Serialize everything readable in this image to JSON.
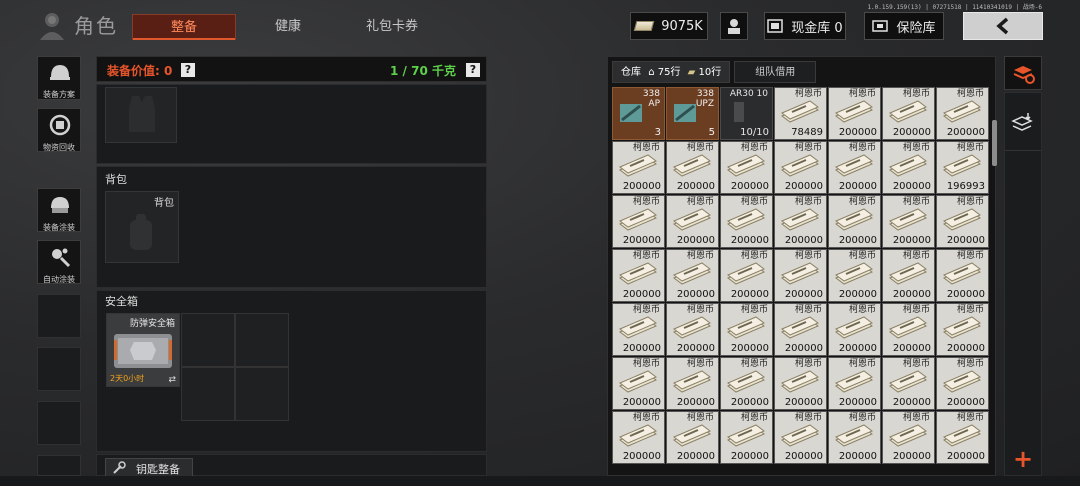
{
  "header": {
    "title": "角色",
    "version": "1.0.159.159(13) | 07271518 | 11410341019 | 战场-6",
    "tabs": [
      {
        "label": "整备",
        "active": true
      },
      {
        "label": "健康",
        "active": false
      },
      {
        "label": "礼包卡券",
        "active": false
      }
    ],
    "currency": "9075K",
    "cash_vault": "现金库 0",
    "safe_vault": "保险库"
  },
  "rail": {
    "items": [
      {
        "label": "装备方案",
        "icon": "helmet-icon"
      },
      {
        "label": "物资回收",
        "icon": "recycle-icon"
      },
      {
        "label": "装备涂装",
        "icon": "paint-helmet-icon"
      },
      {
        "label": "自动涂装",
        "icon": "auto-paint-icon"
      }
    ]
  },
  "equipment": {
    "value_label": "装备价值: 0",
    "help": "?",
    "weight": "1 / 70 千克",
    "backpack_title": "背包",
    "backpack_slot_label": "背包",
    "safebox_title": "安全箱",
    "safebox_item_name": "防弹安全箱",
    "safebox_timer": "2天0小时",
    "key_button": "钥匙整备"
  },
  "inventory": {
    "tab_warehouse": "仓库",
    "rows_label": "75行",
    "cash_rows_label": "10行",
    "tab_team_borrow": "组队借用",
    "columns": 7,
    "cells": [
      {
        "type": "ammo",
        "name": "338\nAP",
        "qty": "3"
      },
      {
        "type": "ammo",
        "name": "338\nUPZ",
        "qty": "5"
      },
      {
        "type": "mag",
        "name": "AR30 10",
        "qty": "10/10"
      },
      {
        "type": "cash",
        "name": "柯恩币",
        "qty": "78489"
      },
      {
        "type": "cash",
        "name": "柯恩币",
        "qty": "200000"
      },
      {
        "type": "cash",
        "name": "柯恩币",
        "qty": "200000"
      },
      {
        "type": "cash",
        "name": "柯恩币",
        "qty": "200000"
      },
      {
        "type": "cash",
        "name": "柯恩币",
        "qty": "200000"
      },
      {
        "type": "cash",
        "name": "柯恩币",
        "qty": "200000"
      },
      {
        "type": "cash",
        "name": "柯恩币",
        "qty": "200000"
      },
      {
        "type": "cash",
        "name": "柯恩币",
        "qty": "200000"
      },
      {
        "type": "cash",
        "name": "柯恩币",
        "qty": "200000"
      },
      {
        "type": "cash",
        "name": "柯恩币",
        "qty": "200000"
      },
      {
        "type": "cash",
        "name": "柯恩币",
        "qty": "196993"
      },
      {
        "type": "cash",
        "name": "柯恩币",
        "qty": "200000"
      },
      {
        "type": "cash",
        "name": "柯恩币",
        "qty": "200000"
      },
      {
        "type": "cash",
        "name": "柯恩币",
        "qty": "200000"
      },
      {
        "type": "cash",
        "name": "柯恩币",
        "qty": "200000"
      },
      {
        "type": "cash",
        "name": "柯恩币",
        "qty": "200000"
      },
      {
        "type": "cash",
        "name": "柯恩币",
        "qty": "200000"
      },
      {
        "type": "cash",
        "name": "柯恩币",
        "qty": "200000"
      },
      {
        "type": "cash",
        "name": "柯恩币",
        "qty": "200000"
      },
      {
        "type": "cash",
        "name": "柯恩币",
        "qty": "200000"
      },
      {
        "type": "cash",
        "name": "柯恩币",
        "qty": "200000"
      },
      {
        "type": "cash",
        "name": "柯恩币",
        "qty": "200000"
      },
      {
        "type": "cash",
        "name": "柯恩币",
        "qty": "200000"
      },
      {
        "type": "cash",
        "name": "柯恩币",
        "qty": "200000"
      },
      {
        "type": "cash",
        "name": "柯恩币",
        "qty": "200000"
      },
      {
        "type": "cash",
        "name": "柯恩币",
        "qty": "200000"
      },
      {
        "type": "cash",
        "name": "柯恩币",
        "qty": "200000"
      },
      {
        "type": "cash",
        "name": "柯恩币",
        "qty": "200000"
      },
      {
        "type": "cash",
        "name": "柯恩币",
        "qty": "200000"
      },
      {
        "type": "cash",
        "name": "柯恩币",
        "qty": "200000"
      },
      {
        "type": "cash",
        "name": "柯恩币",
        "qty": "200000"
      },
      {
        "type": "cash",
        "name": "柯恩币",
        "qty": "200000"
      },
      {
        "type": "cash",
        "name": "柯恩币",
        "qty": "200000"
      },
      {
        "type": "cash",
        "name": "柯恩币",
        "qty": "200000"
      },
      {
        "type": "cash",
        "name": "柯恩币",
        "qty": "200000"
      },
      {
        "type": "cash",
        "name": "柯恩币",
        "qty": "200000"
      },
      {
        "type": "cash",
        "name": "柯恩币",
        "qty": "200000"
      },
      {
        "type": "cash",
        "name": "柯恩币",
        "qty": "200000"
      },
      {
        "type": "cash",
        "name": "柯恩币",
        "qty": "200000"
      },
      {
        "type": "cash",
        "name": "柯恩币",
        "qty": "200000"
      },
      {
        "type": "cash",
        "name": "柯恩币",
        "qty": "200000"
      },
      {
        "type": "cash",
        "name": "柯恩币",
        "qty": "200000"
      },
      {
        "type": "cash",
        "name": "柯恩币",
        "qty": "200000"
      },
      {
        "type": "cash",
        "name": "柯恩币",
        "qty": "200000"
      },
      {
        "type": "cash",
        "name": "柯恩币",
        "qty": "200000"
      },
      {
        "type": "cash",
        "name": "柯恩币",
        "qty": "200000"
      }
    ]
  },
  "side": {
    "add": "+"
  },
  "colors": {
    "accent_orange": "#e8552a",
    "weight_green": "#5ed04b",
    "active_tab_bg": "#5a1f14"
  }
}
